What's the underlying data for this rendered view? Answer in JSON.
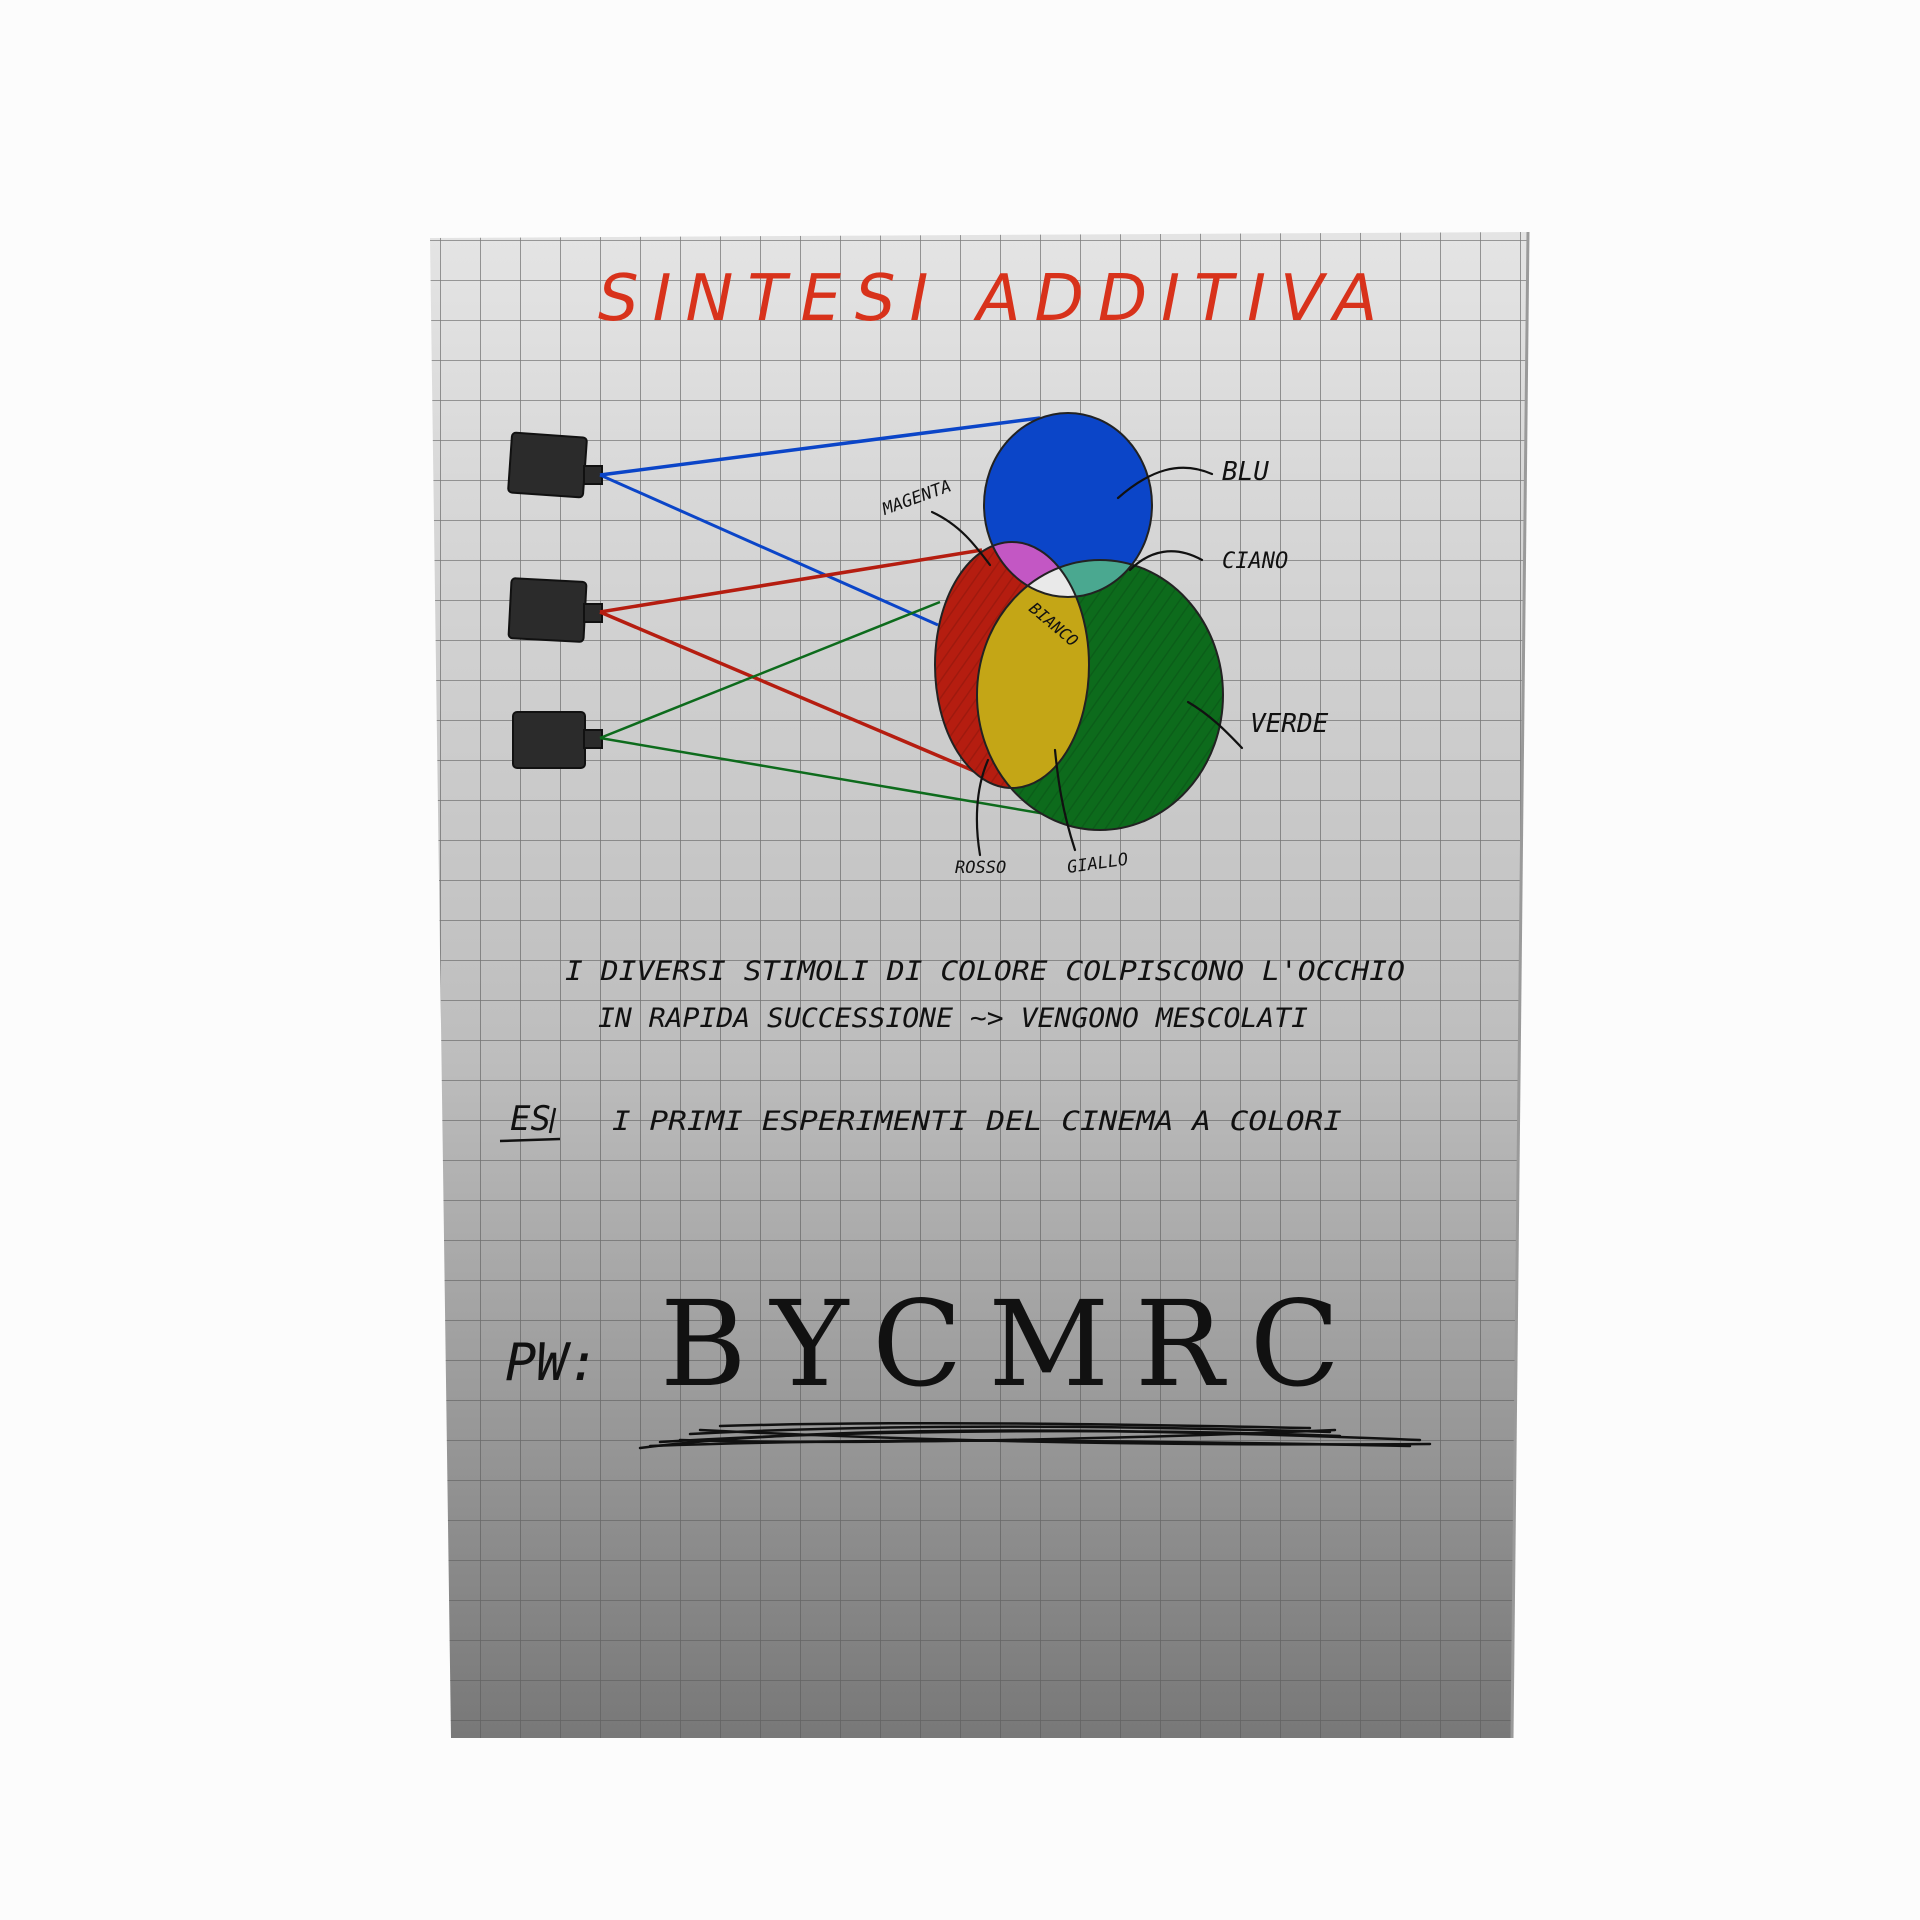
{
  "title": "SINTESI ADDITIVA",
  "colors": {
    "title": "#d8321b",
    "blue": "#0b45c8",
    "red": "#b51d10",
    "green": "#0d6b1c",
    "magenta": "#c357c4",
    "cyan": "#4aa890",
    "yellow": "#c4a616",
    "white": "#e9e9e9",
    "paper_top": "#e4e4e4",
    "paper_bottom": "#787878",
    "grid": "#5a5a5a",
    "projector": "#2b2b2b",
    "ink": "#111111"
  },
  "diagram": {
    "projectors": [
      {
        "icon": "projector-icon",
        "beam": "blue"
      },
      {
        "icon": "projector-icon",
        "beam": "red"
      },
      {
        "icon": "projector-icon",
        "beam": "green"
      }
    ],
    "labels": {
      "blue": "BLU",
      "cyan": "CIANO",
      "green": "VERDE",
      "magenta": "MAGENTA",
      "white": "BIANCO",
      "red": "ROSSO",
      "yellow": "GIALLO"
    }
  },
  "notes": {
    "line1": "I DIVERSI STIMOLI DI COLORE COLPISCONO L'OCCHIO",
    "line2": "IN RAPIDA SUCCESSIONE ~> VENGONO MESCOLATI",
    "example_label": "ES",
    "example_text": "I PRIMI ESPERIMENTI DEL CINEMA A COLORI"
  },
  "password": {
    "label": "PW:",
    "value": "BYCMRC"
  }
}
